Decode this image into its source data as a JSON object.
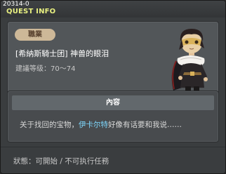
{
  "window": {
    "quest_id": "20314-0",
    "title": "QUEST INFO"
  },
  "quest": {
    "job_label": "職業",
    "name": "[希納斯騎士团] 神兽的眼泪",
    "level_label": "建議等级：",
    "level_range": "70～74"
  },
  "content": {
    "header": "內容",
    "text_before": "关于找回的宝物，",
    "npc_name": "伊卡尔特",
    "text_after": "好像有话要和我说……"
  },
  "status": {
    "text": "狀態：可開始 / 不可执行任務"
  },
  "colors": {
    "title": "#e8f080",
    "npc_highlight": "#7fd9ff",
    "job_badge_bg": "#cdb898"
  }
}
